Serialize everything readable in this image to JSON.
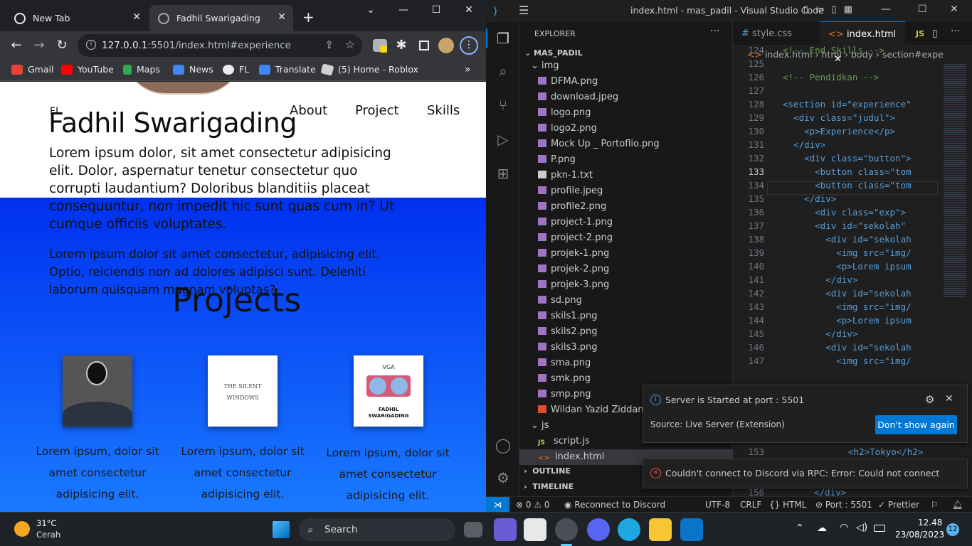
{
  "chrome": {
    "tabs": [
      {
        "title": "New Tab"
      },
      {
        "title": "Fadhil Swarigading"
      }
    ],
    "url": {
      "host": "127.0.0.1",
      "rest": ":5501/index.html#experience"
    },
    "bookmarks": [
      "Gmail",
      "YouTube",
      "Maps",
      "News",
      "FL",
      "Translate",
      "(5) Home - Roblox"
    ]
  },
  "page": {
    "brand": "FL",
    "nav": [
      "About",
      "Project",
      "Skills"
    ],
    "hero_title": "Fadhil Swarigading",
    "hero_p1": "Lorem ipsum dolor, sit amet consectetur adipisicing elit. Dolor, aspernatur tenetur consectetur quo corrupti laudantium? Doloribus blanditiis placeat consequuntur, non impedit hic sunt quas cum in? Ut cumque officiis voluptates.",
    "hero_p2": "Lorem ipsum dolor sit amet consectetur, adipisicing elit. Optio, reiciendis non ad dolores adipisci sunt. Deleniti laborum quisquam magnam voluptas?",
    "projects_title": "Projects",
    "card2_text": "THE SILENT WINDOWS",
    "card3_label": "VGA",
    "card3_name": "FADHIL SWARIGADING",
    "project_text": "Lorem ipsum, dolor sit amet consectetur adipisicing elit."
  },
  "vscode": {
    "title": "index.html - mas_padil - Visual Studio Code",
    "explorer_label": "EXPLORER",
    "root": "MAS_PADIL",
    "files": [
      {
        "name": "img",
        "kind": "folder"
      },
      {
        "name": "DFMA.png",
        "kind": "img"
      },
      {
        "name": "download.jpeg",
        "kind": "img"
      },
      {
        "name": "logo.png",
        "kind": "img"
      },
      {
        "name": "logo2.png",
        "kind": "img"
      },
      {
        "name": "Mock Up _ Portoflio.png",
        "kind": "img"
      },
      {
        "name": "P.png",
        "kind": "img"
      },
      {
        "name": "pkn-1.txt",
        "kind": "txt"
      },
      {
        "name": "profile.jpeg",
        "kind": "img"
      },
      {
        "name": "profile2.png",
        "kind": "img"
      },
      {
        "name": "project-1.png",
        "kind": "img"
      },
      {
        "name": "project-2.png",
        "kind": "img"
      },
      {
        "name": "projek-1.png",
        "kind": "img"
      },
      {
        "name": "projek-2.png",
        "kind": "img"
      },
      {
        "name": "projek-3.png",
        "kind": "img"
      },
      {
        "name": "sd.png",
        "kind": "img"
      },
      {
        "name": "skils1.png",
        "kind": "img"
      },
      {
        "name": "skils2.png",
        "kind": "img"
      },
      {
        "name": "skils3.png",
        "kind": "img"
      },
      {
        "name": "sma.png",
        "kind": "img"
      },
      {
        "name": "smk.png",
        "kind": "img"
      },
      {
        "name": "smp.png",
        "kind": "img"
      },
      {
        "name": "Wildan Yazid Ziddan - ",
        "kind": "pdf"
      },
      {
        "name": "js",
        "kind": "folder"
      },
      {
        "name": "script.js",
        "kind": "js"
      },
      {
        "name": "index.html",
        "kind": "html"
      }
    ],
    "outline": "OUTLINE",
    "timeline": "TIMELINE",
    "tabs": [
      "style.css",
      "index.html",
      "JS"
    ],
    "breadcrumb": [
      "index.html",
      "html",
      "body",
      "section#expe"
    ],
    "line_numbers": [
      "124",
      "125",
      "126",
      "127",
      "128",
      "129",
      "130",
      "131",
      "132",
      "133",
      "134",
      "135",
      "136",
      "137",
      "138",
      "139",
      "140",
      "141",
      "142",
      "143",
      "144",
      "145",
      "146",
      "147"
    ],
    "code_lines": [
      "<!-- End Skills -->",
      "",
      "<!-- Pendidkan -->",
      "",
      "<section id=\"experience\"",
      "  <div class=\"judul\">",
      "    <p>Experience</p>",
      "  </div>",
      "    <div class=\"button\">",
      "      <button class=\"tom",
      "      <button class=\"tom",
      "    </div>",
      "      <div class=\"exp\">",
      "      <div id=\"sekolah\" ",
      "        <div id=\"sekolah",
      "          <img src=\"img/",
      "          <p>Lorem ipsum",
      "        </div>",
      "        <div id=\"sekolah",
      "          <img src=\"img/",
      "          <p>Lorem ipsum",
      "        </div>",
      "        <div id=\"sekolah",
      "          <img src=\"img/"
    ],
    "line_153": "153",
    "code_153": "<h2>Tokyo</h2>",
    "line_156": "156",
    "code_156": "</div>",
    "notif1": {
      "message": "Server is Started at port : 5501",
      "source": "Source: Live Server (Extension)",
      "button": "Don't show again"
    },
    "notif2": {
      "message": "Couldn't connect to Discord via RPC: Error: Could not connect"
    },
    "status": {
      "errors": "0",
      "warnings": "0",
      "discord": "Reconnect to Discord",
      "encoding": "UTF-8",
      "eol": "CRLF",
      "language": "HTML",
      "port": "Port : 5501",
      "prettier": "Prettier"
    }
  },
  "taskbar": {
    "weather_temp": "31°C",
    "weather_desc": "Cerah",
    "search": "Search",
    "time": "12.48",
    "date": "23/08/2023",
    "badge": "12"
  },
  "colors": {
    "vscode_accent": "#0078d4",
    "page_blue": "#0030f0"
  }
}
